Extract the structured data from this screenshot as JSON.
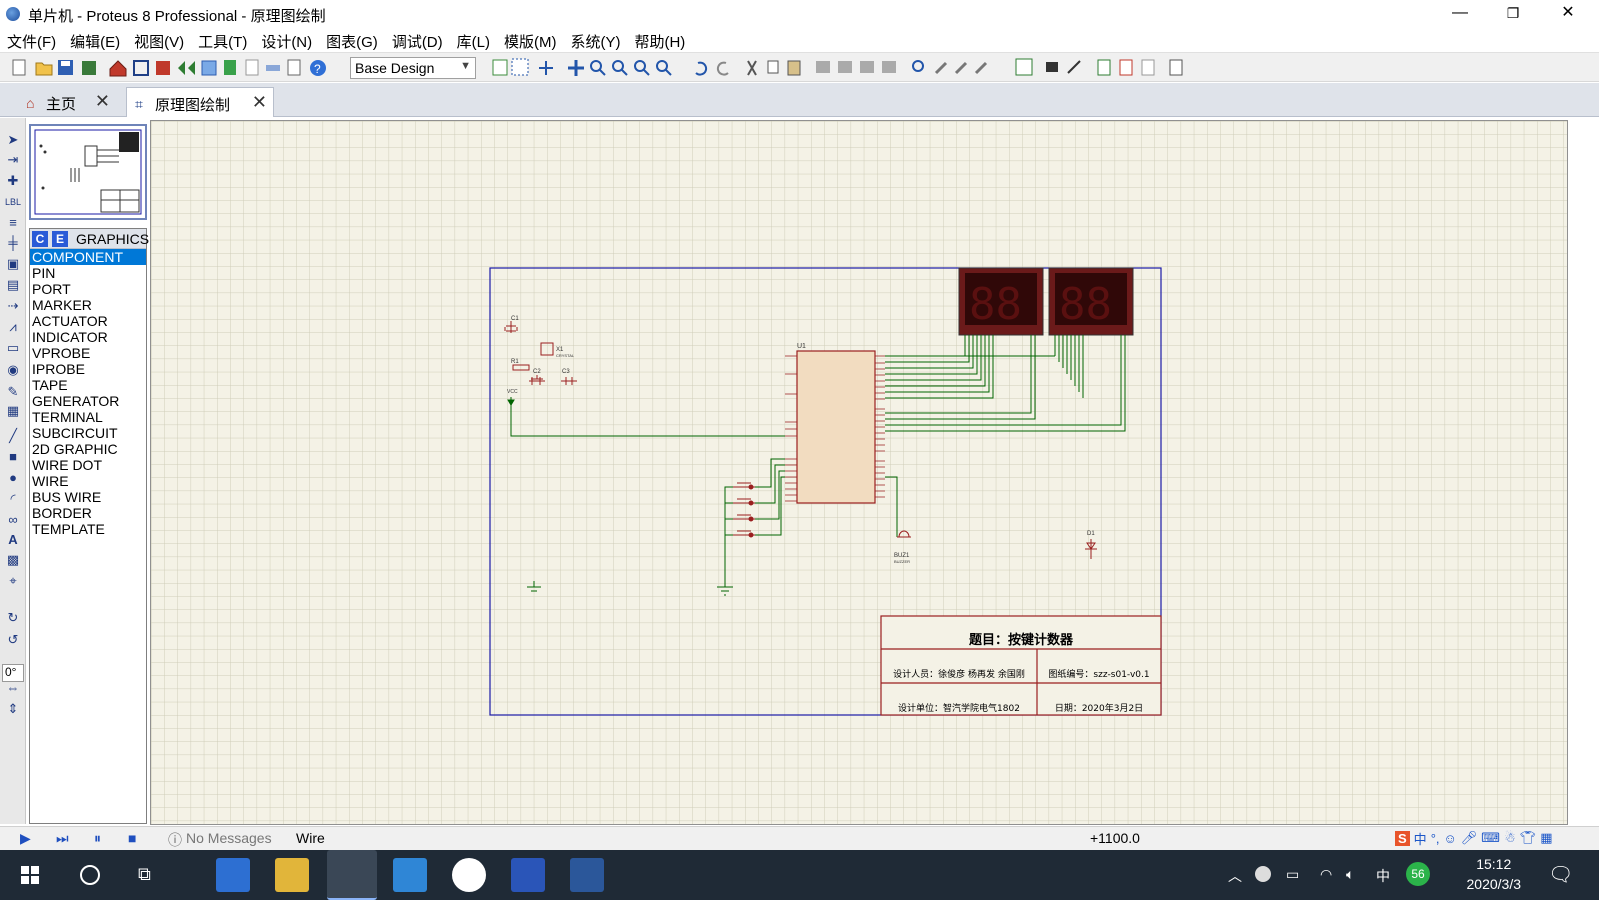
{
  "window": {
    "title": "单片机 - Proteus 8 Professional - 原理图绘制",
    "minimize": "—",
    "maximize": "❐",
    "close": "✕"
  },
  "menu": [
    "文件(F)",
    "编辑(E)",
    "视图(V)",
    "工具(T)",
    "设计(N)",
    "图表(G)",
    "调试(D)",
    "库(L)",
    "模版(M)",
    "系统(Y)",
    "帮助(H)"
  ],
  "toolbar": {
    "design_combo": "Base Design"
  },
  "tabs": [
    {
      "label": "主页",
      "icon": "home-icon"
    },
    {
      "label": "原理图绘制",
      "icon": "schematic-icon"
    }
  ],
  "selector": {
    "btn_c": "C",
    "btn_e": "E",
    "mode_label": "GRAPHICS",
    "items": [
      "COMPONENT",
      "PIN",
      "PORT",
      "MARKER",
      "ACTUATOR",
      "INDICATOR",
      "VPROBE",
      "IPROBE",
      "TAPE",
      "GENERATOR",
      "TERMINAL",
      "SUBCIRCUIT",
      "2D GRAPHIC",
      "WIRE DOT",
      "WIRE",
      "BUS WIRE",
      "BORDER",
      "TEMPLATE"
    ],
    "selected": "COMPONENT"
  },
  "rotation": "0°",
  "schematic": {
    "title_block": {
      "title": "题目：按键计数器",
      "designers": "设计人员：徐俊彦 杨再发 余国刚",
      "drawing_no": "图纸编号：szz-s01-v0.1",
      "unit": "设计单位：智汽学院电气1802",
      "date": "日期：2020年3月2日"
    },
    "labels": {
      "u1": "U1",
      "c1": "C1",
      "c2": "C2",
      "c3": "C3",
      "r1": "R1",
      "x1": "X1",
      "crystal": "CRYSTAL",
      "vcc": "VCC",
      "buz": "BUZ1",
      "buzzer": "BUZZER",
      "d1": "D1"
    }
  },
  "status": {
    "messages": "No Messages",
    "mode": "Wire",
    "coord": "+1100.0"
  },
  "taskbar": {
    "ime_lang": "中",
    "badge": "56",
    "time": "15:12",
    "date": "2020/3/3"
  },
  "colors": {
    "sheet_border": "#1a1aa6",
    "wire": "#006400",
    "component": "#9a1f1f",
    "grid": "#cfcdb8",
    "selected": "#0078d7"
  }
}
